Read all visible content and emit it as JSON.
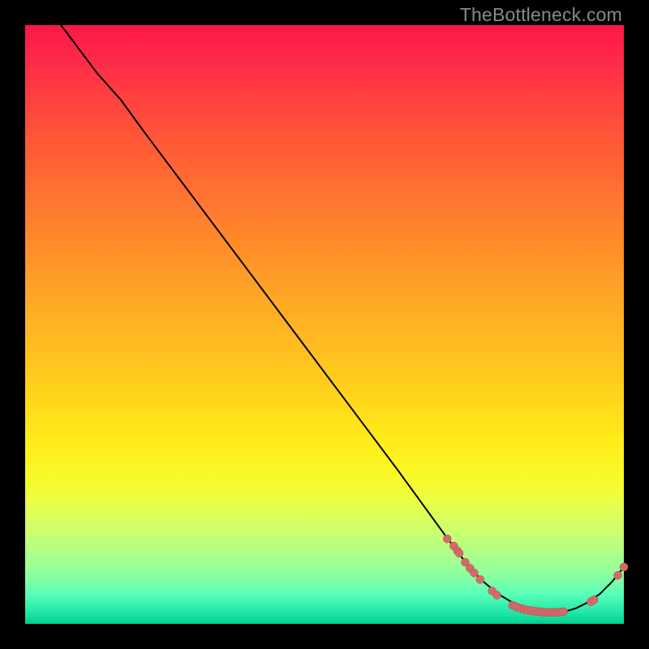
{
  "watermark": "TheBottleneck.com",
  "colors": {
    "point_fill": "#d46a6a",
    "point_stroke": "#b84a4a",
    "line": "#000000"
  },
  "chart_data": {
    "type": "line",
    "title": "",
    "xlabel": "",
    "ylabel": "",
    "xlim": [
      0,
      100
    ],
    "ylim": [
      0,
      100
    ],
    "curve": [
      [
        6,
        100
      ],
      [
        9,
        96
      ],
      [
        12,
        92
      ],
      [
        16,
        87.5
      ],
      [
        20,
        82
      ],
      [
        26,
        74
      ],
      [
        32,
        66
      ],
      [
        38,
        58
      ],
      [
        44,
        50
      ],
      [
        50,
        42
      ],
      [
        56,
        34
      ],
      [
        62,
        26
      ],
      [
        66,
        20.5
      ],
      [
        70,
        15
      ],
      [
        73,
        11
      ],
      [
        76,
        7.5
      ],
      [
        79,
        5
      ],
      [
        82,
        3.2
      ],
      [
        85,
        2.2
      ],
      [
        88,
        1.8
      ],
      [
        90,
        2.0
      ],
      [
        92,
        2.6
      ],
      [
        94,
        3.6
      ],
      [
        96,
        5.0
      ],
      [
        98,
        7.0
      ],
      [
        100,
        9.5
      ]
    ],
    "points": [
      [
        70.5,
        14.2
      ],
      [
        71.6,
        13.0
      ],
      [
        72.2,
        12.2
      ],
      [
        72.5,
        11.8
      ],
      [
        73.5,
        10.3
      ],
      [
        74.3,
        9.3
      ],
      [
        75.0,
        8.5
      ],
      [
        76.0,
        7.4
      ],
      [
        78.0,
        5.5
      ],
      [
        78.8,
        4.8
      ],
      [
        81.4,
        3.1
      ],
      [
        81.9,
        2.9
      ],
      [
        82.4,
        2.7
      ],
      [
        82.9,
        2.55
      ],
      [
        83.4,
        2.4
      ],
      [
        83.9,
        2.3
      ],
      [
        84.4,
        2.22
      ],
      [
        84.9,
        2.14
      ],
      [
        85.4,
        2.08
      ],
      [
        85.9,
        2.02
      ],
      [
        86.4,
        1.98
      ],
      [
        86.9,
        1.94
      ],
      [
        87.4,
        1.92
      ],
      [
        87.9,
        1.9
      ],
      [
        88.4,
        1.92
      ],
      [
        88.9,
        1.94
      ],
      [
        89.4,
        1.98
      ],
      [
        89.9,
        2.04
      ],
      [
        94.5,
        3.7
      ],
      [
        95.0,
        4.0
      ],
      [
        99.0,
        8.1
      ],
      [
        100.0,
        9.5
      ]
    ],
    "point_radius": 5
  }
}
